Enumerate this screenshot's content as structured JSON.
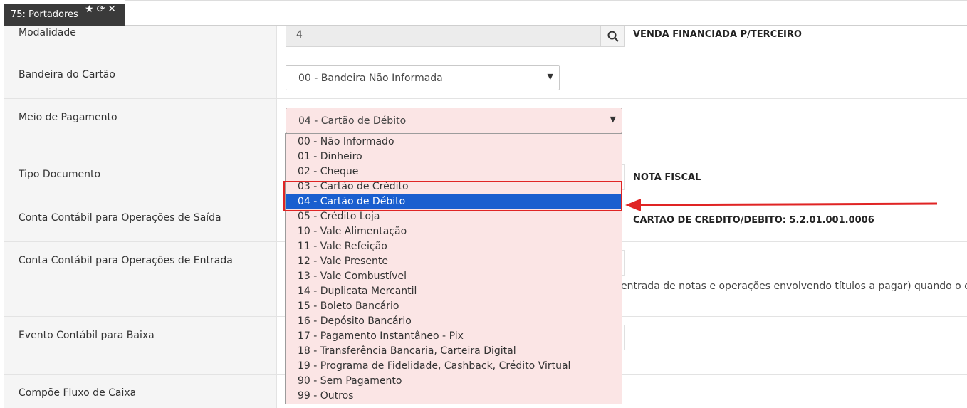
{
  "tab": {
    "title": "75: Portadores",
    "icons": [
      "star-icon",
      "refresh-icon",
      "close-icon"
    ]
  },
  "fields": {
    "modalidade": {
      "label": "Modalidade",
      "value": "4",
      "description": "VENDA FINANCIADA P/TERCEIRO"
    },
    "bandeira": {
      "label": "Bandeira do Cartão",
      "selected": "00 - Bandeira Não Informada"
    },
    "meio_pagamento": {
      "label": "Meio de Pagamento",
      "selected": "04 - Cartão de Débito"
    },
    "tipo_documento": {
      "label": "Tipo Documento",
      "description": "NOTA FISCAL"
    },
    "conta_saida": {
      "label": "Conta Contábil para Operações de Saída",
      "description": "CARTAO DE CREDITO/DEBITO: 5.2.01.001.0006"
    },
    "conta_entrada": {
      "label": "Conta Contábil para Operações de Entrada",
      "help": "entrada de notas e operações envolvendo títulos a pagar) quando o eve"
    },
    "evento_baixa": {
      "label": "Evento Contábil para Baixa"
    },
    "fluxo_caixa": {
      "label": "Compõe Fluxo de Caixa"
    }
  },
  "dropdown": {
    "options": [
      "00 - Não Informado",
      "01 - Dinheiro",
      "02 - Cheque",
      "03 - Cartão de Crédito",
      "04 - Cartão de Débito",
      "05 - Crédito Loja",
      "10 - Vale Alimentação",
      "11 - Vale Refeição",
      "12 - Vale Presente",
      "13 - Vale Combustível",
      "14 - Duplicata Mercantil",
      "15 - Boleto Bancário",
      "16 - Depósito Bancário",
      "17 - Pagamento Instantâneo - Pix",
      "18 - Transferência Bancaria, Carteira Digital",
      "19 - Programa de Fidelidade, Cashback, Crédito Virtual",
      "90 - Sem Pagamento",
      "99 - Outros"
    ],
    "selected_index": 4
  },
  "colors": {
    "highlight": "#1a5fcf",
    "annotation": "#e02424",
    "select_bg": "#fbe5e5"
  }
}
